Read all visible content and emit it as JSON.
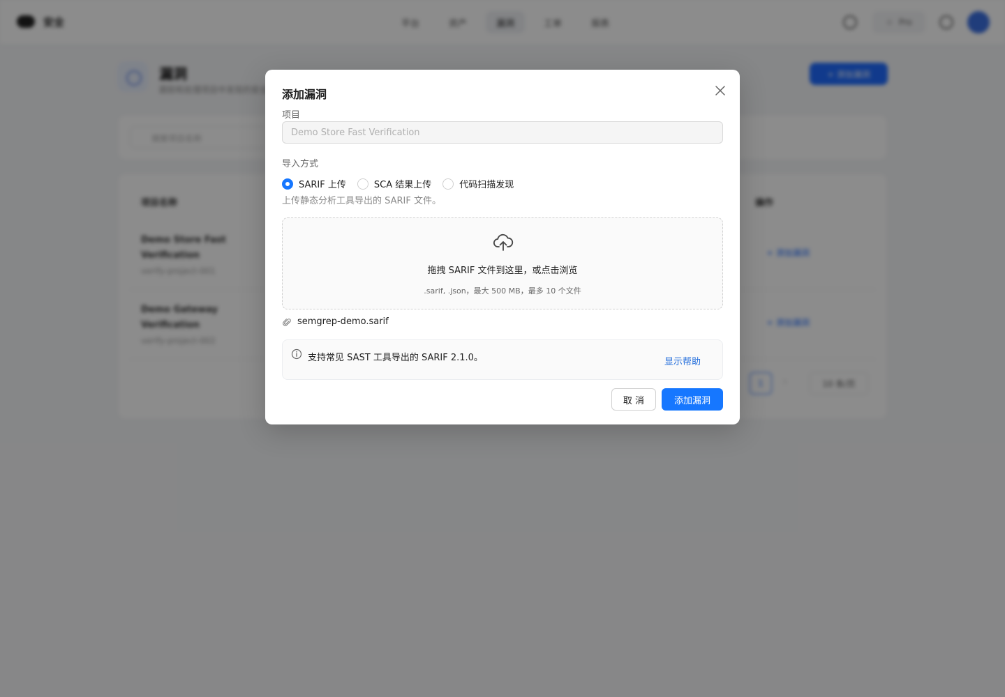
{
  "background": {
    "topbar": {
      "logo_text": "安全",
      "nav": [
        "平台",
        "资产",
        "漏洞",
        "工单",
        "报表"
      ],
      "active_nav_index": 2,
      "pill_label": "Pro"
    },
    "header": {
      "title": "漏洞",
      "subtitle": "跟踪和处理项目中发现的安全漏洞",
      "primary_button": "+ 添加漏洞"
    },
    "filter": {
      "search_placeholder": "搜索项目名称"
    },
    "table": {
      "col_project": "项目名称",
      "col_actions": "操作",
      "rows": [
        {
          "name": "Demo Store Fast Verification",
          "meta": "verify-project-001",
          "action": "+ 添加漏洞"
        },
        {
          "name": "Demo Gateway Verification",
          "meta": "verify-project-002",
          "action": "+ 添加漏洞"
        }
      ],
      "pager_current": "1",
      "pager_next": "›",
      "pager_size": "10 条/页"
    }
  },
  "modal": {
    "title": "添加漏洞",
    "project_label": "项目",
    "project_value": "Demo Store Fast Verification",
    "import_label": "导入方式",
    "radios": [
      {
        "label": "SARIF 上传",
        "checked": true
      },
      {
        "label": "SCA 结果上传",
        "checked": false
      },
      {
        "label": "代码扫描发现",
        "checked": false
      }
    ],
    "radio_hint": "上传静态分析工具导出的 SARIF 文件。",
    "dropzone": {
      "main": "拖拽 SARIF 文件到这里，或点击浏览",
      "sub": ".sarif, .json，最大 500 MB，最多 10 个文件"
    },
    "file_name": "semgrep-demo.sarif",
    "info": {
      "text": "支持常见 SAST 工具导出的 SARIF 2.1.0。",
      "link": "显示帮助"
    },
    "cancel_label": "取 消",
    "submit_label": "添加漏洞"
  },
  "colors": {
    "primary": "#1677ff",
    "link": "#1f6bdb",
    "overlay": "rgba(0,0,0,0.45)"
  }
}
